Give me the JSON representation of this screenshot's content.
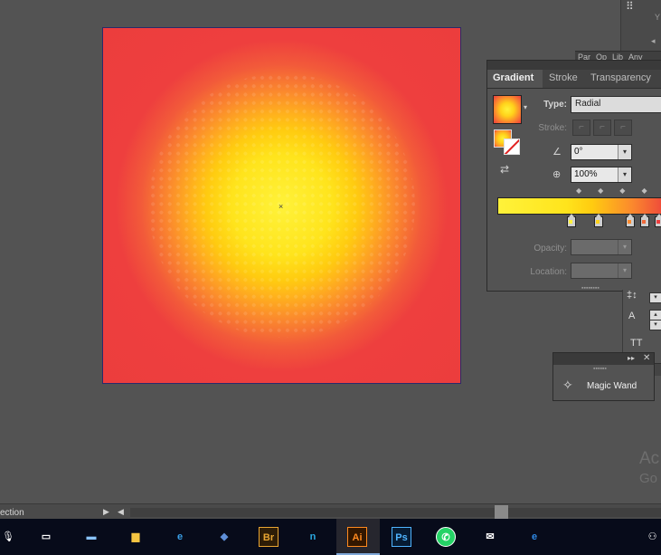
{
  "canvas": {
    "center_marker": "×"
  },
  "dock": {
    "glyph": "⠿",
    "y_label": "Y",
    "collapse": "◂",
    "mini_tabs": [
      "Par",
      "Op",
      "Lib",
      "Any"
    ]
  },
  "gradient_panel": {
    "tabs": [
      "Gradient",
      "Stroke",
      "Transparency"
    ],
    "active_tab": "Gradient",
    "thumb_arrow": "▾",
    "type_label": "Type:",
    "type_value": "Radial",
    "stroke_label": "Stroke:",
    "stroke_buttons": [
      "⌐",
      "⌐",
      "⌐"
    ],
    "angle_icon": "∠",
    "angle_value": "0°",
    "aspect_icon": "⊕",
    "aspect_value": "100%",
    "dropdown_arrow": "▾",
    "midpoints": "◆◆◆◆",
    "stop_colors": [
      "#fff23a",
      "#ffd21a",
      "#fb8a2d",
      "#f06a3a",
      "#ec3d3d"
    ],
    "opacity_label": "Opacity:",
    "location_label": "Location:",
    "grip": "▪▪▪▪▪▪▪▪",
    "reverse_icon": "⇄"
  },
  "character_strip": {
    "leading_icon": "‡↕",
    "tracking_icon": "A",
    "caps_label": "TT"
  },
  "magic_wand_panel": {
    "expand": "▸▸",
    "close": "✕",
    "grip": "▪▪▪▪▪▪",
    "icon": "✧",
    "label": "Magic Wand"
  },
  "watermark": {
    "line1": "Ac",
    "line2": "Go"
  },
  "status_bar": {
    "text": "ection",
    "arrow": "▶",
    "scroll_left": "◀"
  },
  "taskbar": {
    "apps": [
      {
        "name": "task-view",
        "glyph": "▭",
        "color": "#ffffff",
        "bg": "transparent"
      },
      {
        "name": "this-pc",
        "glyph": "▬",
        "color": "#8ac4ff",
        "bg": "transparent"
      },
      {
        "name": "file-explorer",
        "glyph": "▆",
        "color": "#f5c542",
        "bg": "transparent"
      },
      {
        "name": "internet-explorer",
        "glyph": "e",
        "color": "#3aa0e8",
        "bg": "transparent"
      },
      {
        "name": "unknown-app",
        "glyph": "◆",
        "color": "#5f8fd8",
        "bg": "transparent"
      },
      {
        "name": "bridge",
        "glyph": "Br",
        "color": "#e8a532",
        "bg": "#2e1d07"
      },
      {
        "name": "nitro",
        "glyph": "n",
        "color": "#2aa8e0",
        "bg": "transparent"
      },
      {
        "name": "illustrator",
        "glyph": "Ai",
        "color": "#ff8a1f",
        "bg": "#331700"
      },
      {
        "name": "photoshop",
        "glyph": "Ps",
        "color": "#4fb4ff",
        "bg": "#061b33"
      },
      {
        "name": "whatsapp",
        "glyph": "✆",
        "color": "#ffffff",
        "bg": "#25d366"
      },
      {
        "name": "mail",
        "glyph": "✉",
        "color": "#ffffff",
        "bg": "transparent"
      },
      {
        "name": "edge",
        "glyph": "e",
        "color": "#2f8ae6",
        "bg": "transparent"
      }
    ],
    "mic": "🎙",
    "people": "⚇"
  }
}
